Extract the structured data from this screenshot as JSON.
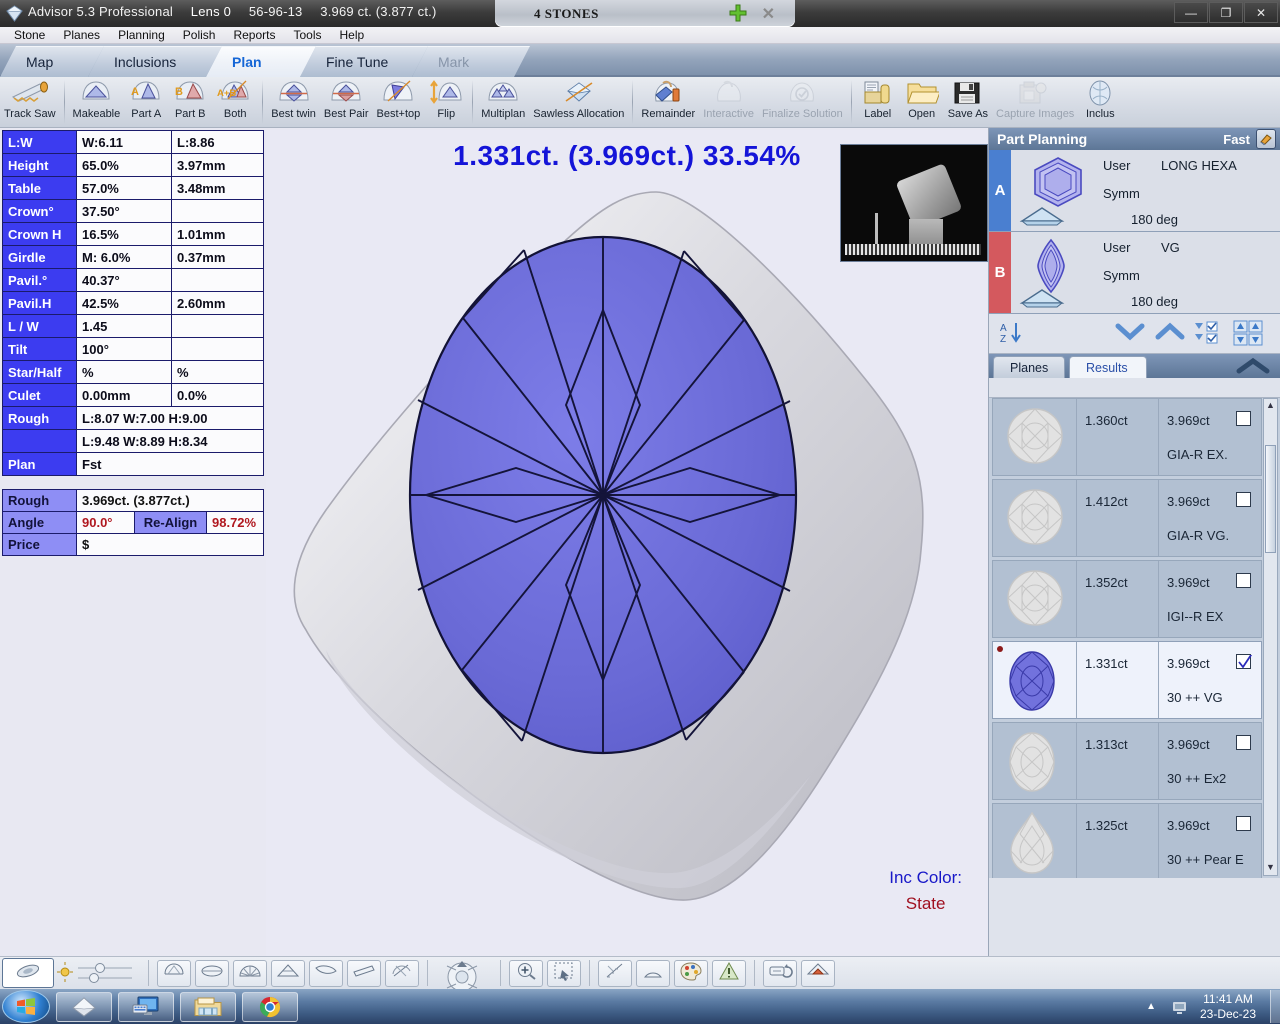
{
  "titlebar": {
    "app_name": "Advisor 5.3 Professional",
    "lens": "Lens 0",
    "stone_id": "56-96-13",
    "weight": "3.969 ct. (3.877 ct.)",
    "doc_tab": "4 STONES",
    "minimize": "—",
    "maximize": "❐",
    "close": "✕"
  },
  "menu": {
    "items": [
      "Stone",
      "Planes",
      "Planning",
      "Polish",
      "Reports",
      "Tools",
      "Help"
    ]
  },
  "tabs": [
    {
      "label": "Map",
      "state": "normal"
    },
    {
      "label": "Inclusions",
      "state": "normal"
    },
    {
      "label": "Plan",
      "state": "active"
    },
    {
      "label": "Fine Tune",
      "state": "normal"
    },
    {
      "label": "Mark",
      "state": "disabled"
    }
  ],
  "toolbar": [
    {
      "label": "Track Saw",
      "icon": "saw-icon",
      "dim": false
    },
    {
      "sep": true
    },
    {
      "label": "Makeable",
      "icon": "gem-makeable-icon",
      "dim": false
    },
    {
      "label": "Part A",
      "icon": "gem-part-a-icon",
      "dim": false
    },
    {
      "label": "Part B",
      "icon": "gem-part-b-icon",
      "dim": false
    },
    {
      "label": "Both",
      "icon": "gem-both-icon",
      "dim": false
    },
    {
      "sep": true
    },
    {
      "label": "Best twin",
      "icon": "best-twin-icon",
      "dim": false
    },
    {
      "label": "Best Pair",
      "icon": "best-pair-icon",
      "dim": false
    },
    {
      "label": "Best+top",
      "icon": "best-top-icon",
      "dim": false
    },
    {
      "label": "Flip",
      "icon": "flip-icon",
      "dim": false
    },
    {
      "sep": true
    },
    {
      "label": "Multiplan",
      "icon": "multiplan-icon",
      "dim": false
    },
    {
      "label": "Sawless Allocation",
      "icon": "sawless-allocation-icon",
      "dim": false
    },
    {
      "sep": true
    },
    {
      "label": "Remainder",
      "icon": "remainder-icon",
      "dim": false
    },
    {
      "label": "Interactive",
      "icon": "interactive-icon",
      "dim": true
    },
    {
      "label": "Finalize Solution",
      "icon": "finalize-solution-icon",
      "dim": true
    },
    {
      "sep": true
    },
    {
      "label": "Label",
      "icon": "label-icon",
      "dim": false
    },
    {
      "label": "Open",
      "icon": "folder-open-icon",
      "dim": false
    },
    {
      "label": "Save As",
      "icon": "save-as-icon",
      "dim": false
    },
    {
      "label": "Capture Images",
      "icon": "capture-images-icon",
      "dim": true
    },
    {
      "label": "Inclus",
      "icon": "inclusions-icon",
      "dim": false
    }
  ],
  "params": {
    "rows": [
      {
        "name": "L:W",
        "v1": "W:6.11",
        "v2": "L:8.86"
      },
      {
        "name": "Height",
        "v1": "65.0%",
        "v2": "3.97mm"
      },
      {
        "name": "Table",
        "v1": "57.0%",
        "v2": "3.48mm"
      },
      {
        "name": "Crown°",
        "v1": "37.50°",
        "v2": ""
      },
      {
        "name": "Crown H",
        "v1": "16.5%",
        "v2": "1.01mm"
      },
      {
        "name": "Girdle",
        "v1": "M: 6.0%",
        "v2": "0.37mm"
      },
      {
        "name": "Pavil.°",
        "v1": "40.37°",
        "v2": ""
      },
      {
        "name": "Pavil.H",
        "v1": "42.5%",
        "v2": "2.60mm"
      },
      {
        "name": "L / W",
        "v1": "1.45",
        "v2": ""
      },
      {
        "name": "Tilt",
        "v1": "100°",
        "v2": ""
      },
      {
        "name": "Star/Half",
        "v1": "%",
        "v2": "%"
      },
      {
        "name": "Culet",
        "v1": "0.00mm",
        "v2": "0.0%"
      }
    ],
    "rough_label": "Rough",
    "rough_line1": "L:8.07 W:7.00 H:9.00",
    "rough_line2": "L:9.48 W:8.89 H:8.34",
    "plan_label": "Plan",
    "plan_value": "Fst"
  },
  "summary": {
    "rough_label": "Rough",
    "rough_value": "3.969ct. (3.877ct.)",
    "angle_label": "Angle",
    "angle_value": "90.0°",
    "realign_label": "Re-Align",
    "realign_value": "98.72%",
    "price_label": "Price",
    "price_value": "$"
  },
  "viewport": {
    "headline": "1.331ct. (3.969ct.) 33.54%",
    "inc_color_label": "Inc Color:",
    "inc_color_state": "State"
  },
  "part_planning": {
    "title": "Part Planning",
    "mode": "Fast",
    "eraser_icon": "eraser-icon",
    "rows": [
      {
        "tag": "A",
        "shape_icon": "hexagon-gem-icon",
        "user_label": "User",
        "user_value": "LONG HEXA",
        "symm_label": "Symm",
        "deg": "180 deg"
      },
      {
        "tag": "B",
        "shape_icon": "marquise-gem-icon",
        "user_label": "User",
        "user_value": "VG",
        "symm_label": "Symm",
        "deg": "180 deg"
      }
    ]
  },
  "sortbar": {
    "sort_icon": "sort-az-icon",
    "down_icon": "chevron-down-icon",
    "up_icon": "chevron-up-icon",
    "checklist_icon": "check-list-icon",
    "grid_icon": "grid-arrows-icon"
  },
  "result_tabs": [
    {
      "label": "Planes",
      "active": false
    },
    {
      "label": "Results",
      "active": true
    }
  ],
  "results": [
    {
      "shape_icon": "round-gem-icon",
      "carat": "1.360ct",
      "rough": "3.969ct",
      "grade": "GIA-R EX.",
      "checked": false,
      "selected": false,
      "marker": false
    },
    {
      "shape_icon": "round-gem-icon",
      "carat": "1.412ct",
      "rough": "3.969ct",
      "grade": "GIA-R VG.",
      "checked": false,
      "selected": false,
      "marker": false
    },
    {
      "shape_icon": "round-gem-icon",
      "carat": "1.352ct",
      "rough": "3.969ct",
      "grade": "IGI--R EX",
      "checked": false,
      "selected": false,
      "marker": false
    },
    {
      "shape_icon": "oval-gem-icon",
      "carat": "1.331ct",
      "rough": "3.969ct",
      "grade": "30 ++  VG",
      "checked": true,
      "selected": true,
      "marker": true
    },
    {
      "shape_icon": "oval-gem-icon",
      "carat": "1.313ct",
      "rough": "3.969ct",
      "grade": "30 ++  Ex2",
      "checked": false,
      "selected": false,
      "marker": false
    },
    {
      "shape_icon": "pear-gem-icon",
      "carat": "1.325ct",
      "rough": "3.969ct",
      "grade": "30 ++  Pear E",
      "checked": false,
      "selected": false,
      "marker": false
    }
  ],
  "bottom_toolbar": [
    {
      "icon": "lens-view-icon",
      "active": true
    },
    {
      "icon": "brightness-slider-icon",
      "active": false
    },
    {
      "icon": "wire-model-icon",
      "active": false
    },
    {
      "icon": "girdle-view-icon",
      "active": false
    },
    {
      "icon": "facet-view-icon",
      "active": false
    },
    {
      "icon": "crown-view-icon",
      "active": false
    },
    {
      "icon": "pavilion-view-icon",
      "active": false
    },
    {
      "icon": "side-view-icon",
      "active": false
    },
    {
      "icon": "cut-view-icon",
      "active": false
    },
    {
      "icon": "navigate-pad-icon",
      "active": false
    },
    {
      "icon": "zoom-in-icon",
      "active": false
    },
    {
      "icon": "select-region-icon",
      "active": false
    },
    {
      "icon": "measure-icon",
      "active": false
    },
    {
      "icon": "shape-icon",
      "active": false
    },
    {
      "icon": "palette-icon",
      "active": false
    },
    {
      "icon": "warning-icon",
      "active": false
    },
    {
      "icon": "rotate-icon",
      "active": false
    },
    {
      "icon": "home-view-icon",
      "active": false
    }
  ],
  "taskbar": {
    "start_icon": "windows-start-icon",
    "tasks": [
      {
        "icon": "advisor-app-icon"
      },
      {
        "icon": "display-settings-icon"
      },
      {
        "icon": "file-explorer-icon"
      },
      {
        "icon": "chrome-icon"
      }
    ],
    "tray_expand_icon": "tray-chevron-up-icon",
    "tray_network_icon": "network-icon",
    "time": "11:41 AM",
    "date": "23-Dec-23"
  },
  "topright_controls": [
    {
      "icon": "pan-arrows-icon",
      "name": "pan-toggle"
    },
    {
      "icon": "record-icon",
      "name": "record-button"
    },
    {
      "icon": "settings-grid-icon",
      "name": "view-settings"
    },
    {
      "icon": "help-icon",
      "name": "help-button"
    }
  ],
  "colors": {
    "accent_blue": "#1414d8",
    "header_blue": "#3c3cf0",
    "tag_a": "#4a7fd0",
    "tag_b": "#d4595e",
    "gem_fill": "#6b6bd8",
    "state_red": "#a01020"
  }
}
